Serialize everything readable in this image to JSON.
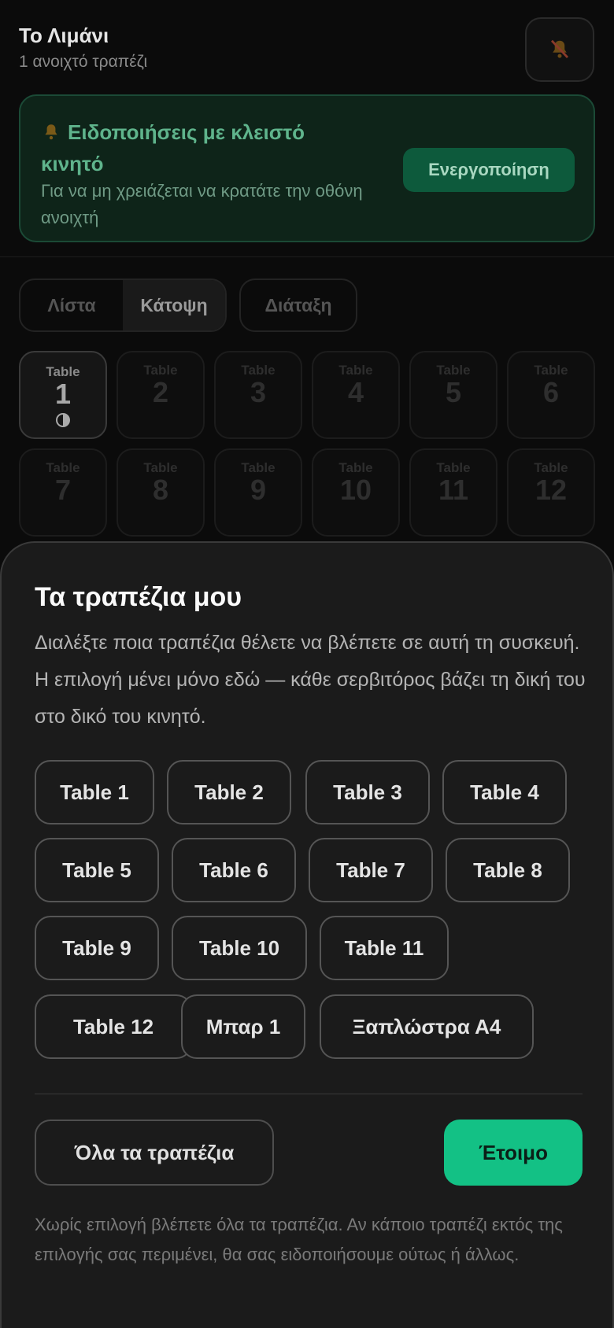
{
  "header": {
    "title": "Το Λιμάνι",
    "subtitle": "1 ανοιχτό τραπέζι",
    "bell_icon": "bell-off-icon"
  },
  "notification_card": {
    "icon": "bell-icon",
    "title": "Ειδοποιήσεις με κλειστό κινητό",
    "description": "Για να μη χρειάζεται να κρατάτε την οθόνη ανοιχτή",
    "button_label": "Ενεργοποίηση"
  },
  "view_tabs": [
    {
      "label": "Λίστα",
      "active": false
    },
    {
      "label": "Κάτοψη",
      "active": true
    }
  ],
  "arrange_label": "Διάταξη",
  "floor_tiles": [
    {
      "word": "Table",
      "number": "1",
      "selected": true,
      "status_icon": "half-circle-icon"
    },
    {
      "word": "Table",
      "number": "2",
      "selected": false
    },
    {
      "word": "Table",
      "number": "3",
      "selected": false
    },
    {
      "word": "Table",
      "number": "4",
      "selected": false
    },
    {
      "word": "Table",
      "number": "5",
      "selected": false
    },
    {
      "word": "Table",
      "number": "6",
      "selected": false
    },
    {
      "word": "Table",
      "number": "7",
      "selected": false
    },
    {
      "word": "Table",
      "number": "8",
      "selected": false
    },
    {
      "word": "Table",
      "number": "9",
      "selected": false
    },
    {
      "word": "Table",
      "number": "10",
      "selected": false
    },
    {
      "word": "Table",
      "number": "11",
      "selected": false
    },
    {
      "word": "Table",
      "number": "12",
      "selected": false
    }
  ],
  "sheet": {
    "title": "Τα τραπέζια μου",
    "description": "Διαλέξτε ποια τραπέζια θέλετε να βλέπετε σε αυτή τη συσκευή. Η επιλογή μένει μόνο εδώ — κάθε σερβιτόρος βάζει τη δική του στο δικό του κινητό.",
    "chips": [
      "Table 1",
      "Table 2",
      "Table 3",
      "Table 4",
      "Table 5",
      "Table 6",
      "Table 7",
      "Table 8",
      "Table 9",
      "Table 10",
      "Table 11",
      "Table 12",
      "Μπαρ 1",
      "Ξαπλώστρα Α4"
    ],
    "all_tables_label": "Όλα τα τραπέζια",
    "ready_label": "Έτοιμο",
    "footer_note": "Χωρίς επιλογή βλέπετε όλα τα τραπέζια. Αν κάποιο τραπέζι εκτός της επιλογής σας περιμένει, θα σας ειδοποιήσουμε ούτως ή άλλως."
  },
  "colors": {
    "accent": "#13c185",
    "sheet_bg": "#1b1b1b",
    "page_bg": "#0b0b0b"
  }
}
